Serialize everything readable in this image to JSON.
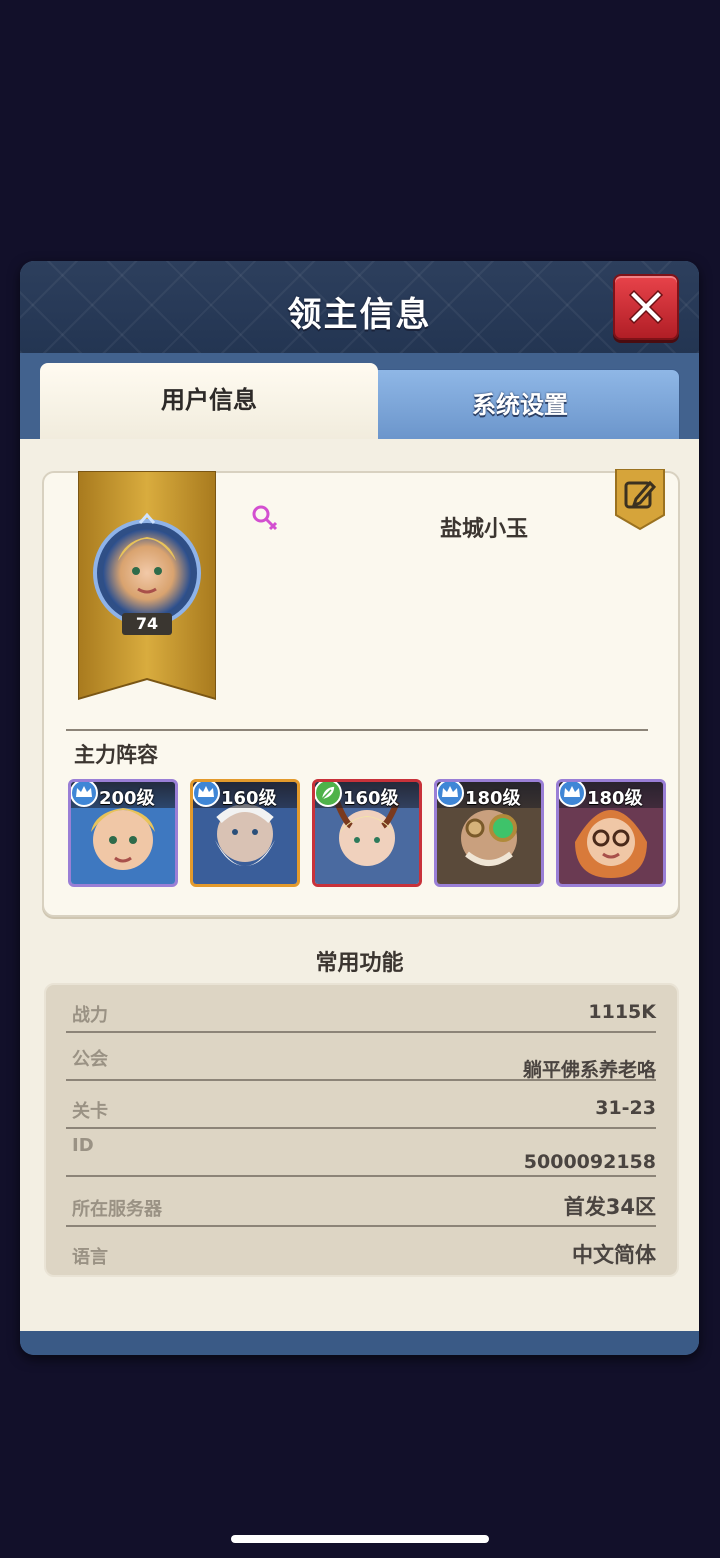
{
  "dialog": {
    "title": "领主信息",
    "tabs": [
      {
        "label": "用户信息",
        "active": true
      },
      {
        "label": "系统设置",
        "active": false
      }
    ]
  },
  "profile": {
    "avatar_level": "74",
    "gender_icon": "female-symbol-icon",
    "player_name": "盐城小玉",
    "edit_icon": "edit-pencil-icon"
  },
  "lineup": {
    "label": "主力阵容",
    "heroes": [
      {
        "level": "200级",
        "badge": "crown-icon",
        "frame": "#9a7fd6"
      },
      {
        "level": "160级",
        "badge": "crown-icon",
        "frame": "#e39a2c"
      },
      {
        "level": "160级",
        "badge": "leaf-icon",
        "frame": "#c8323a"
      },
      {
        "level": "180级",
        "badge": "crown-icon",
        "frame": "#9a7fd6"
      },
      {
        "level": "180级",
        "badge": "crown-icon",
        "frame": "#9a7fd6"
      }
    ]
  },
  "functions": {
    "title": "常用功能",
    "rows": [
      {
        "label": "战力",
        "value": "1115K"
      },
      {
        "label": "公会",
        "value": "躺平佛系养老咯"
      },
      {
        "label": "关卡",
        "value": "31-23"
      },
      {
        "label": "ID",
        "value": "5000092158"
      },
      {
        "label": "所在服务器",
        "value": "首发34区"
      },
      {
        "label": "语言",
        "value": "中文简体"
      }
    ]
  },
  "colors": {
    "accent_red": "#c8323a",
    "tab_blue": "#7aa4d8",
    "banner_gold": "#c99a2e"
  }
}
